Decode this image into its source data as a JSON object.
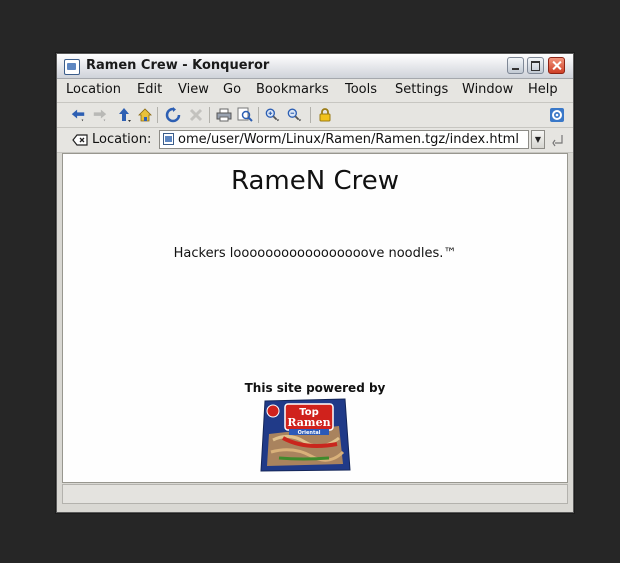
{
  "window": {
    "title": "Ramen Crew - Konqueror"
  },
  "menubar": {
    "items": [
      {
        "label": "Location"
      },
      {
        "label": "Edit"
      },
      {
        "label": "View"
      },
      {
        "label": "Go"
      },
      {
        "label": "Bookmarks"
      },
      {
        "label": "Tools"
      },
      {
        "label": "Settings"
      },
      {
        "label": "Window"
      },
      {
        "label": "Help"
      }
    ]
  },
  "toolbar": {
    "buttons": [
      "back-icon",
      "forward-icon",
      "up-icon",
      "home-icon",
      "reload-icon",
      "stop-icon",
      "print-icon",
      "find-icon",
      "zoom-in-icon",
      "zoom-out-icon",
      "security-lock-icon",
      "kde-gear-icon"
    ]
  },
  "location": {
    "label": "Location:",
    "url": "ome/user/Worm/Linux/Ramen/Ramen.tgz/index.html"
  },
  "page": {
    "heading": "RameN Crew",
    "tagline": "Hackers looooooooooooooooove noodles.™",
    "powered_by": "This site powered by",
    "logo_text_top": "Top",
    "logo_text_main": "Ramen",
    "logo_text_flavor": "Oriental"
  },
  "colors": {
    "desktop": "#262626",
    "window_bg": "#d9d8d3",
    "content_bg": "#fefefe",
    "ramen_blue": "#243f8f",
    "ramen_red": "#d0221c"
  },
  "status": {
    "text": ""
  }
}
